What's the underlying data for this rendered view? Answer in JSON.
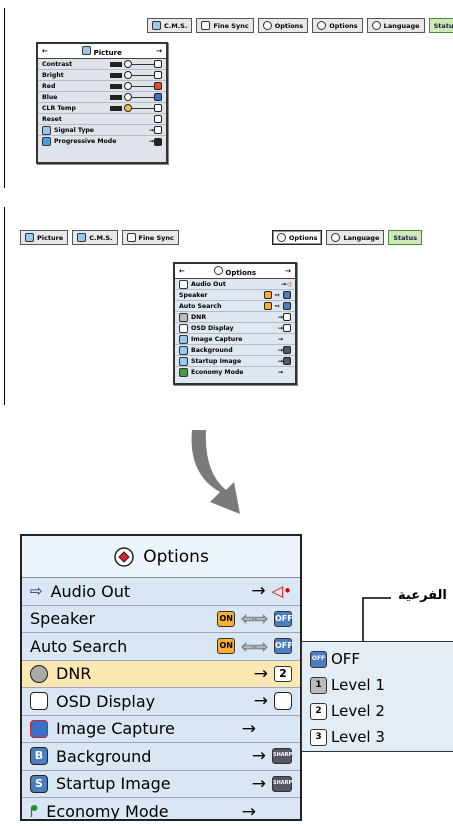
{
  "screen1": {
    "tabs": [
      "C.M.S.",
      "Fine Sync",
      "Options",
      "Options",
      "Language",
      "Status"
    ],
    "panel": {
      "title": "Picture",
      "rows": [
        "Contrast",
        "Bright",
        "Red",
        "Blue",
        "CLR Temp",
        "Reset",
        "Signal Type",
        "Progressive Mode"
      ]
    }
  },
  "screen2": {
    "left_tabs": [
      "Picture",
      "C.M.S.",
      "Fine Sync"
    ],
    "right_tabs": [
      "Options",
      "Language",
      "Status"
    ],
    "panel": {
      "title": "Options",
      "rows": [
        "Audio Out",
        "Speaker",
        "Auto Search",
        "DNR",
        "OSD Display",
        "Image Capture",
        "Background",
        "Startup Image",
        "Economy Mode"
      ]
    }
  },
  "big": {
    "title": "Options",
    "rows": [
      "Audio Out",
      "Speaker",
      "Auto Search",
      "DNR",
      "OSD Display",
      "Image Capture",
      "Background",
      "Startup Image",
      "Economy Mode"
    ],
    "on": "ON",
    "off": "OFF",
    "sharp": "SHARP",
    "dnr_value": "2"
  },
  "submenu": {
    "label": "الفرعية",
    "items": [
      "OFF",
      "Level 1",
      "Level 2",
      "Level 3"
    ],
    "item_icons": [
      "OFF",
      "1",
      "2",
      "3"
    ]
  },
  "colors": {
    "status_tab": "#cfe9b8",
    "selected_row": "#fde8b4",
    "panel": "#d9e6f4"
  }
}
